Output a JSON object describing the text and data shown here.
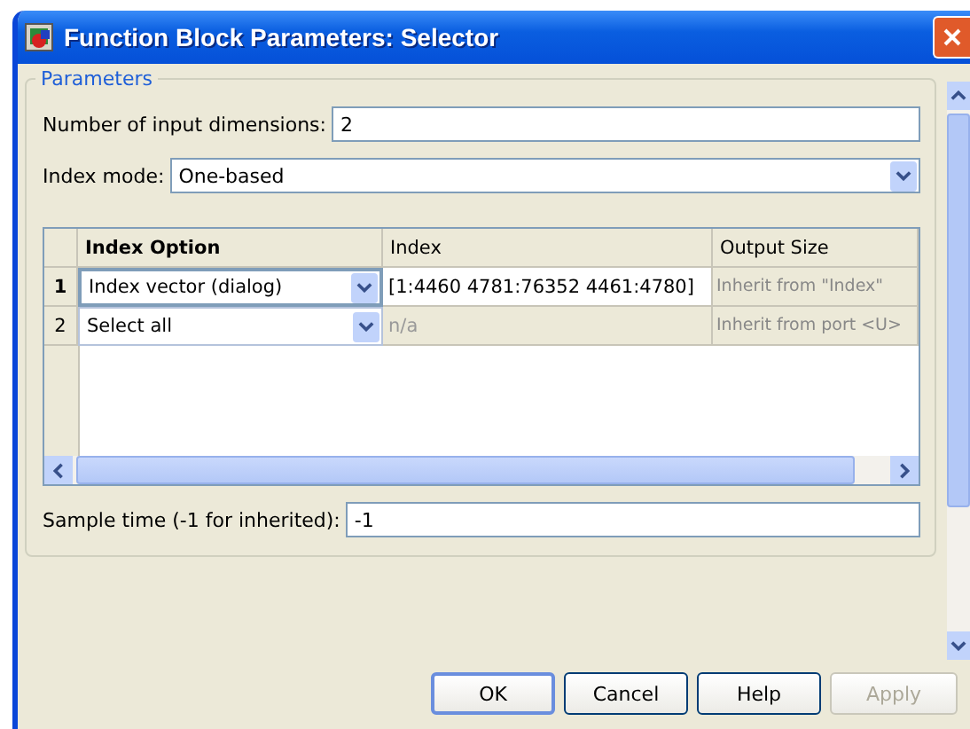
{
  "window": {
    "title": "Function Block Parameters: Selector"
  },
  "parameters": {
    "legend": "Parameters",
    "dimensions": {
      "label": "Number of input dimensions:",
      "value": "2"
    },
    "index_mode": {
      "label": "Index mode:",
      "value": "One-based"
    },
    "table": {
      "columns": [
        "Index Option",
        "Index",
        "Output Size"
      ],
      "rows": [
        {
          "number": "1",
          "selected": true,
          "option": "Index vector (dialog)",
          "index": "[1:4460 4781:76352 4461:4780]",
          "index_disabled": false,
          "output_size": "Inherit from \"Index\""
        },
        {
          "number": "2",
          "selected": false,
          "option": "Select all",
          "index": "n/a",
          "index_disabled": true,
          "output_size": "Inherit from port <U>"
        }
      ]
    },
    "sample_time": {
      "label": "Sample time (-1 for inherited):",
      "value": "-1"
    }
  },
  "buttons": [
    {
      "label": "OK",
      "default": true,
      "disabled": false
    },
    {
      "label": "Cancel",
      "default": false,
      "disabled": false
    },
    {
      "label": "Help",
      "default": false,
      "disabled": false
    },
    {
      "label": "Apply",
      "default": false,
      "disabled": true
    }
  ]
}
